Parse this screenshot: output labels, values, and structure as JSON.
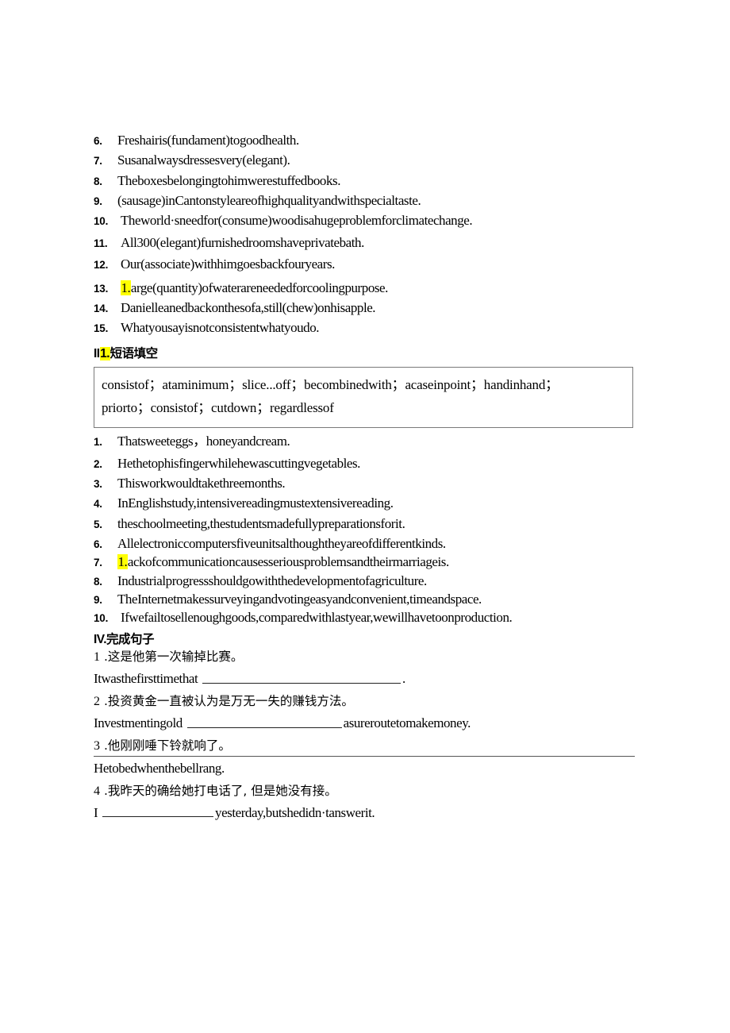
{
  "document": {
    "type": "english-exercise-worksheet"
  },
  "colors": {
    "highlight": "#ffff00",
    "text": "#000000",
    "box_border": "#7a7a7a",
    "rule": "#555555"
  },
  "word_form_section": {
    "items": [
      {
        "num": "6.",
        "text": "Freshairis(fundament)togoodhealth."
      },
      {
        "num": "7.",
        "text": "Susanalwaysdressesvery(elegant)."
      },
      {
        "num": "8.",
        "text": "Theboxesbelongingtohimwerestuffedbooks."
      },
      {
        "num": "9.",
        "text": "(sausage)inCantonstyleareofhighqualityandwithspecialtaste."
      },
      {
        "num": "10.",
        "text": "Theworld·sneedfor(consume)woodisahugeproblemforclimatechange."
      },
      {
        "num": "11.",
        "text": "All300(elegant)furnishedroomshaveprivatebath."
      },
      {
        "num": "12.",
        "text": "Our(associate)withhimgoesbackfouryears."
      },
      {
        "num": "13.",
        "highlight": "1.",
        "text": "arge(quantity)ofwaterareneededforcoolingpurpose."
      },
      {
        "num": "14.",
        "text": "Danielleanedbackonthesofa,still(chew)onhisapple."
      },
      {
        "num": "15.",
        "text": "Whatyousayisnotconsistentwhatyoudo."
      }
    ]
  },
  "phrase_section": {
    "heading_prefix": "II",
    "heading_highlight": "1.",
    "heading_title": "短语填空",
    "bank": {
      "line1": "consistof；ataminimum；slice...off；becombinedwith；acaseinpoint；handinhand；",
      "line2": "priorto；consistof；cutdown；regardlessof"
    },
    "items": [
      {
        "num": "1.",
        "text": "Thatsweeteggs，honeyandcream."
      },
      {
        "num": "2.",
        "text": "Hethetophisfingerwhilehewascuttingvegetables."
      },
      {
        "num": "3.",
        "text": "Thisworkwouldtakethreemonths."
      },
      {
        "num": "4.",
        "text": "InEnglishstudy,intensivereadingmustextensivereading."
      },
      {
        "num": "5.",
        "text": "theschoolmeeting,thestudentsmadefullypreparationsforit."
      },
      {
        "num": "6.",
        "text": "Allelectroniccomputersfiveunitsalthoughtheyareofdifferentkinds."
      },
      {
        "num": "7.",
        "highlight": "1.",
        "text": "ackofcommunicationcausesseriousproblemsandtheirmarriageis."
      },
      {
        "num": "8.",
        "text": "Industrialprogressshouldgowiththedevelopmentofagriculture."
      },
      {
        "num": "9.",
        "text": "TheInternetmakessurveyingandvotingeasyandconvenient,timeandspace."
      },
      {
        "num": "10.",
        "text": "Ifwefailtosellenoughgoods,comparedwithlastyear,wewillhavetoonproduction."
      }
    ]
  },
  "completion_section": {
    "heading": "IV.完成句子",
    "items": [
      {
        "index": "1",
        "chinese": ".这是他第一次输掉比赛。",
        "english_before": "Itwasthefirsttimethat ",
        "english_after": "."
      },
      {
        "index": "2",
        "chinese": ".投资黄金一直被认为是万无一失的赚钱方法。",
        "english_before": "Investmentingold ",
        "english_after": "asureroutetomakemoney."
      },
      {
        "index": "3",
        "chinese": ".他刚刚唾下铃就响了。",
        "english_before": "Hetobedwhenthebellrang.",
        "english_after": ""
      },
      {
        "index": "4",
        "chinese": ".我昨天的确给她打电话了, 但是她没有接。",
        "english_before": "I ",
        "english_after": "yesterday,butshedidn·tanswerit."
      }
    ]
  }
}
